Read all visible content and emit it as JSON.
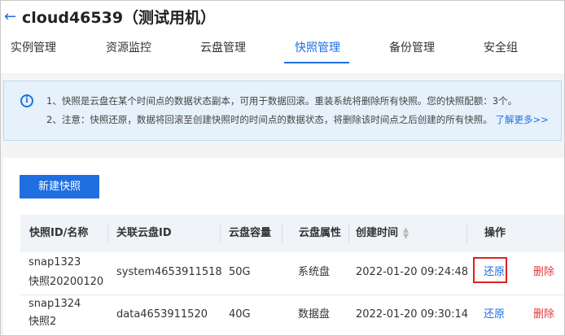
{
  "header": {
    "title": "cloud46539（测试用机）",
    "tabs": [
      "实例管理",
      "资源监控",
      "云盘管理",
      "快照管理",
      "备份管理",
      "安全组"
    ],
    "active_tab": "快照管理"
  },
  "notice": {
    "line1": "1、快照是云盘在某个时间点的数据状态副本，可用于数据回滚。重装系统将删除所有快照。您的快照配额：3个。",
    "line2": "2、注意：快照还原，数据将回滚至创建快照时的时间点的数据状态，将删除该时间点之后创建的所有快照。",
    "learn_more": "了解更多>>"
  },
  "toolbar": {
    "create_label": "新建快照"
  },
  "table": {
    "headers": [
      "快照ID/名称",
      "关联云盘ID",
      "云盘容量",
      "云盘属性",
      "创建时间",
      "操作"
    ],
    "rows": [
      {
        "snap_id": "snap1323",
        "snap_name": "快照20200120",
        "disk_id": "system4653911518",
        "capacity": "50G",
        "attribute": "系统盘",
        "created": "2022-01-20 09:24:48",
        "restore": "还原",
        "delete": "删除"
      },
      {
        "snap_id": "snap1324",
        "snap_name": "快照2",
        "disk_id": "data4653911520",
        "capacity": "40G",
        "attribute": "数据盘",
        "created": "2022-01-20 09:30:14",
        "restore": "还原",
        "delete": "删除"
      }
    ]
  },
  "colors": {
    "accent": "#1f6fe0",
    "danger": "#e23a3a",
    "highlight_border": "#e02020"
  },
  "icons": {
    "back": "arrow-left-icon",
    "info": "info-circle-icon",
    "sort": "sort-icon"
  }
}
